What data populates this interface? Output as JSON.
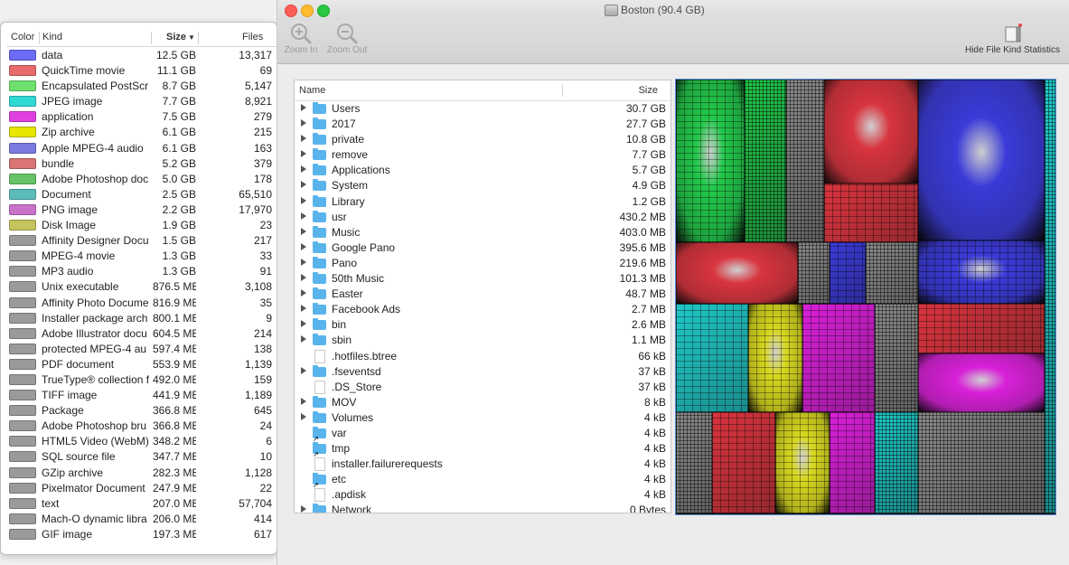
{
  "window": {
    "title": "Boston (90.4 GB)"
  },
  "toolbar": {
    "zoom_in": "Zoom In",
    "zoom_out": "Zoom Out",
    "hide_stats": "Hide File Kind Statistics"
  },
  "kind_panel": {
    "headers": {
      "color": "Color",
      "kind": "Kind",
      "size": "Size",
      "files": "Files"
    },
    "rows": [
      {
        "color": "#6b6bf5",
        "kind": "data",
        "size": "12.5 GB",
        "files": "13,317"
      },
      {
        "color": "#e86a6a",
        "kind": "QuickTime movie",
        "size": "11.1 GB",
        "files": "69"
      },
      {
        "color": "#6ee06e",
        "kind": "Encapsulated PostScr",
        "size": "8.7 GB",
        "files": "5,147"
      },
      {
        "color": "#2fd9d4",
        "kind": "JPEG image",
        "size": "7.7 GB",
        "files": "8,921"
      },
      {
        "color": "#e040e0",
        "kind": "application",
        "size": "7.5 GB",
        "files": "279"
      },
      {
        "color": "#e6e600",
        "kind": "Zip archive",
        "size": "6.1 GB",
        "files": "215"
      },
      {
        "color": "#7a7ae0",
        "kind": "Apple MPEG-4 audio",
        "size": "6.1 GB",
        "files": "163"
      },
      {
        "color": "#d97575",
        "kind": "bundle",
        "size": "5.2 GB",
        "files": "379"
      },
      {
        "color": "#66c466",
        "kind": "Adobe Photoshop doc",
        "size": "5.0 GB",
        "files": "178"
      },
      {
        "color": "#5cbcbc",
        "kind": "Document",
        "size": "2.5 GB",
        "files": "65,510"
      },
      {
        "color": "#c872c8",
        "kind": "PNG image",
        "size": "2.2 GB",
        "files": "17,970"
      },
      {
        "color": "#c4c45c",
        "kind": "Disk Image",
        "size": "1.9 GB",
        "files": "23"
      },
      {
        "color": "#9a9a9a",
        "kind": "Affinity Designer Docu",
        "size": "1.5 GB",
        "files": "217"
      },
      {
        "color": "#9a9a9a",
        "kind": "MPEG-4 movie",
        "size": "1.3 GB",
        "files": "33"
      },
      {
        "color": "#9a9a9a",
        "kind": "MP3 audio",
        "size": "1.3 GB",
        "files": "91"
      },
      {
        "color": "#9a9a9a",
        "kind": "Unix executable",
        "size": "876.5 MB",
        "files": "3,108"
      },
      {
        "color": "#9a9a9a",
        "kind": "Affinity Photo Docume",
        "size": "816.9 MB",
        "files": "35"
      },
      {
        "color": "#9a9a9a",
        "kind": "Installer package arch",
        "size": "800.1 MB",
        "files": "9"
      },
      {
        "color": "#9a9a9a",
        "kind": "Adobe Illustrator docu",
        "size": "604.5 MB",
        "files": "214"
      },
      {
        "color": "#9a9a9a",
        "kind": "protected MPEG-4 au",
        "size": "597.4 MB",
        "files": "138"
      },
      {
        "color": "#9a9a9a",
        "kind": "PDF document",
        "size": "553.9 MB",
        "files": "1,139"
      },
      {
        "color": "#9a9a9a",
        "kind": "TrueType® collection f",
        "size": "492.0 MB",
        "files": "159"
      },
      {
        "color": "#9a9a9a",
        "kind": "TIFF image",
        "size": "441.9 MB",
        "files": "1,189"
      },
      {
        "color": "#9a9a9a",
        "kind": "Package",
        "size": "366.8 MB",
        "files": "645"
      },
      {
        "color": "#9a9a9a",
        "kind": "Adobe Photoshop bru",
        "size": "366.8 MB",
        "files": "24"
      },
      {
        "color": "#9a9a9a",
        "kind": "HTML5 Video (WebM)",
        "size": "348.2 MB",
        "files": "6"
      },
      {
        "color": "#9a9a9a",
        "kind": "SQL source file",
        "size": "347.7 MB",
        "files": "10"
      },
      {
        "color": "#9a9a9a",
        "kind": "GZip archive",
        "size": "282.3 MB",
        "files": "1,128"
      },
      {
        "color": "#9a9a9a",
        "kind": "Pixelmator Document",
        "size": "247.9 MB",
        "files": "22"
      },
      {
        "color": "#9a9a9a",
        "kind": "text",
        "size": "207.0 MB",
        "files": "57,704"
      },
      {
        "color": "#9a9a9a",
        "kind": "Mach-O dynamic libra",
        "size": "206.0 MB",
        "files": "414"
      },
      {
        "color": "#9a9a9a",
        "kind": "GIF image",
        "size": "197.3 MB",
        "files": "617"
      }
    ]
  },
  "browser": {
    "headers": {
      "name": "Name",
      "size": "Size"
    },
    "rows": [
      {
        "name": "Users",
        "size": "30.7 GB",
        "type": "folder",
        "expandable": true
      },
      {
        "name": "2017",
        "size": "27.7 GB",
        "type": "folder",
        "expandable": true
      },
      {
        "name": "private",
        "size": "10.8 GB",
        "type": "folder",
        "expandable": true
      },
      {
        "name": "remove",
        "size": "7.7 GB",
        "type": "folder",
        "expandable": true
      },
      {
        "name": "Applications",
        "size": "5.7 GB",
        "type": "folder",
        "expandable": true
      },
      {
        "name": "System",
        "size": "4.9 GB",
        "type": "folder",
        "expandable": true
      },
      {
        "name": "Library",
        "size": "1.2 GB",
        "type": "folder",
        "expandable": true
      },
      {
        "name": "usr",
        "size": "430.2 MB",
        "type": "folder",
        "expandable": true
      },
      {
        "name": "Music",
        "size": "403.0 MB",
        "type": "folder",
        "expandable": true
      },
      {
        "name": "Google Pano",
        "size": "395.6 MB",
        "type": "folder",
        "expandable": true
      },
      {
        "name": "Pano",
        "size": "219.6 MB",
        "type": "folder",
        "expandable": true
      },
      {
        "name": "50th Music",
        "size": "101.3 MB",
        "type": "folder",
        "expandable": true
      },
      {
        "name": "Easter",
        "size": "48.7 MB",
        "type": "folder",
        "expandable": true
      },
      {
        "name": "Facebook Ads",
        "size": "2.7 MB",
        "type": "folder",
        "expandable": true
      },
      {
        "name": "bin",
        "size": "2.6 MB",
        "type": "folder",
        "expandable": true
      },
      {
        "name": "sbin",
        "size": "1.1 MB",
        "type": "folder",
        "expandable": true
      },
      {
        "name": ".hotfiles.btree",
        "size": "66 kB",
        "type": "file",
        "expandable": false
      },
      {
        "name": ".fseventsd",
        "size": "37 kB",
        "type": "folder",
        "expandable": true
      },
      {
        "name": ".DS_Store",
        "size": "37 kB",
        "type": "file",
        "expandable": false
      },
      {
        "name": "MOV",
        "size": "8 kB",
        "type": "folder",
        "expandable": true
      },
      {
        "name": "Volumes",
        "size": "4 kB",
        "type": "folder",
        "expandable": true
      },
      {
        "name": "var",
        "size": "4 kB",
        "type": "alias",
        "expandable": false
      },
      {
        "name": "tmp",
        "size": "4 kB",
        "type": "alias",
        "expandable": false
      },
      {
        "name": "installer.failurerequests",
        "size": "4 kB",
        "type": "file",
        "expandable": false
      },
      {
        "name": "etc",
        "size": "4 kB",
        "type": "alias",
        "expandable": false
      },
      {
        "name": ".apdisk",
        "size": "4 kB",
        "type": "file",
        "expandable": false
      },
      {
        "name": "Network",
        "size": "0 Bytes",
        "type": "folder",
        "expandable": true
      }
    ]
  },
  "treemap": {
    "colors": {
      "green": "#22c84a",
      "red": "#d8343e",
      "blue": "#3a3ad8",
      "cyan": "#20c8c8",
      "yellow": "#d8d820",
      "magenta": "#d820d8",
      "gray": "#8a8a8a"
    }
  }
}
